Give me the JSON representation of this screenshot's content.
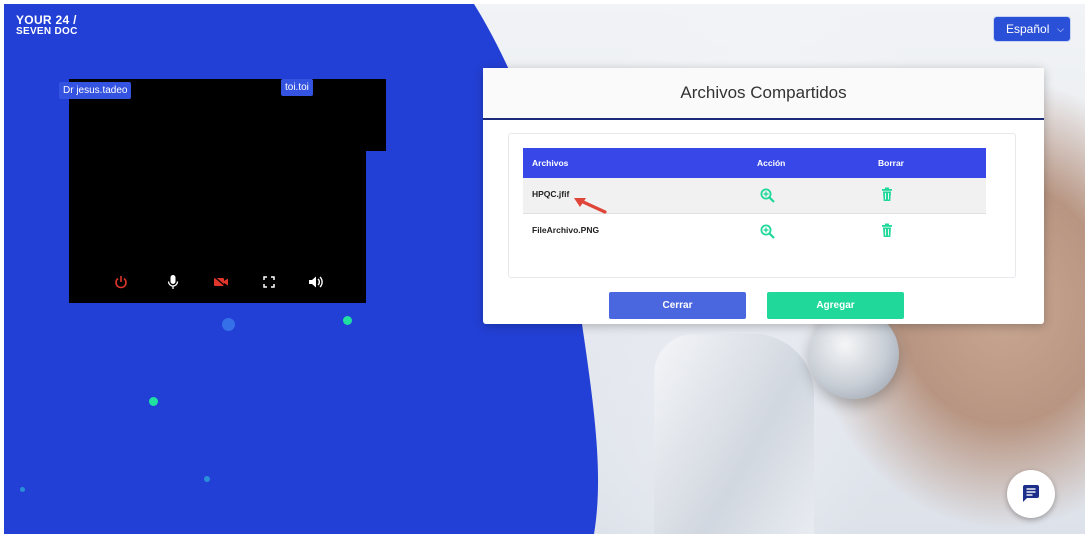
{
  "brand": {
    "line1": "YOUR 24 /",
    "line2": "SEVEN DOC"
  },
  "language": {
    "selected": "Español"
  },
  "video": {
    "remote_label": "Dr jesus.tadeo",
    "local_label": "toi.toi",
    "controls": [
      "power-icon",
      "microphone-icon",
      "camera-off-icon",
      "fullscreen-icon",
      "volume-icon"
    ]
  },
  "modal": {
    "title": "Archivos Compartidos",
    "columns": [
      "Archivos",
      "Acción",
      "Borrar"
    ],
    "files": [
      {
        "name": "HPQC.jfif"
      },
      {
        "name": "FileArchivo.PNG"
      }
    ],
    "close_label": "Cerrar",
    "add_label": "Agregar"
  },
  "colors": {
    "brand_blue": "#2340d6",
    "table_header": "#3848e8",
    "accent_green": "#1fd89a",
    "button_blue": "#4a67e0",
    "end_call_red": "#e0362c"
  }
}
